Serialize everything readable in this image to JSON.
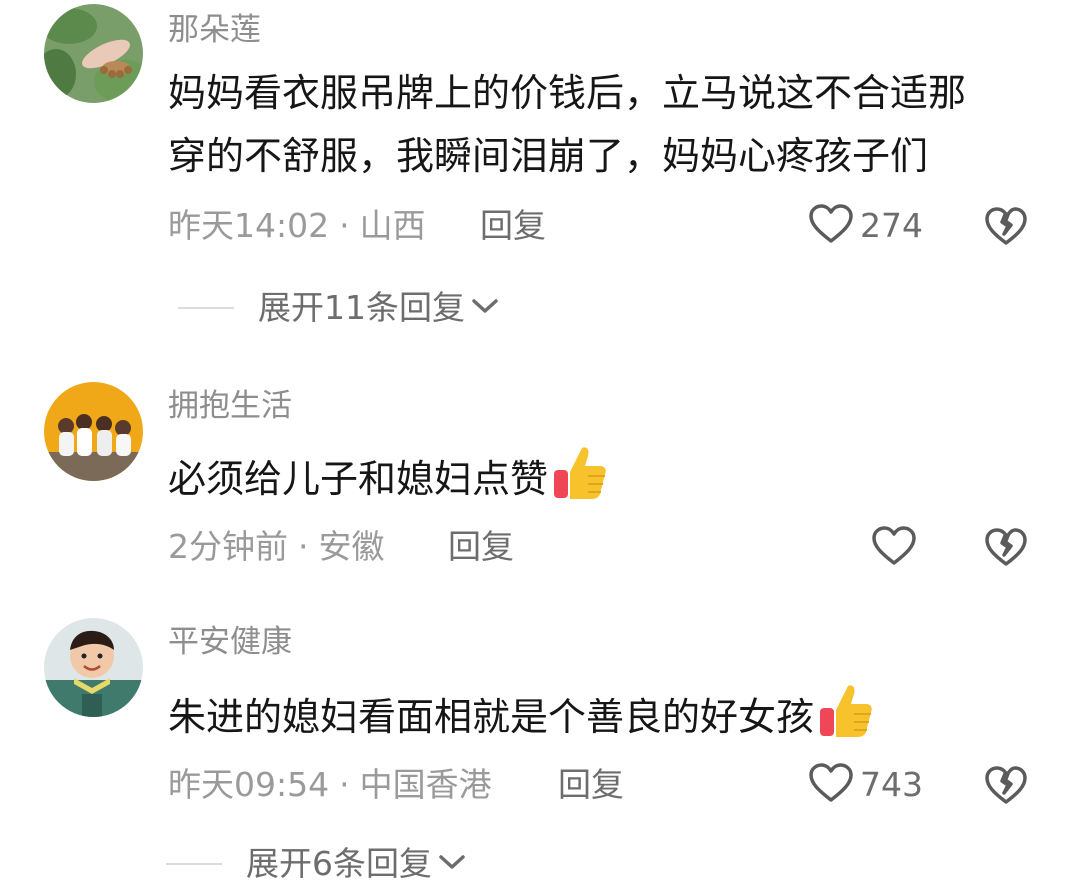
{
  "comments": [
    {
      "username": "那朵莲",
      "text_lines": [
        "妈妈看衣服吊牌上的价钱后，立马说这不合适那",
        "穿的不舒服，我瞬间泪崩了，妈妈心疼孩子们"
      ],
      "time": "昨天14:02",
      "location": "山西",
      "reply_label": "回复",
      "likes": "274",
      "expand_label": "展开11条回复"
    },
    {
      "username": "拥抱生活",
      "text": "必须给儿子和媳妇点赞",
      "time": "2分钟前",
      "location": "安徽",
      "reply_label": "回复"
    },
    {
      "username": "平安健康",
      "text": "朱进的媳妇看面相就是个善良的好女孩",
      "time": "昨天09:54",
      "location": "中国香港",
      "reply_label": "回复",
      "likes": "743",
      "expand_label": "展开6条回复"
    }
  ],
  "separator": "·",
  "icons": {
    "like": "heart-outline-icon",
    "dislike": "broken-heart-icon",
    "expand": "chevron-down-icon",
    "emoji": "thumbs-up-emoji"
  },
  "colors": {
    "username": "#8e8e8e",
    "text": "#161616",
    "meta": "#9a9a9a",
    "action": "#6d6d6d",
    "thumb": "#f7c02d"
  }
}
